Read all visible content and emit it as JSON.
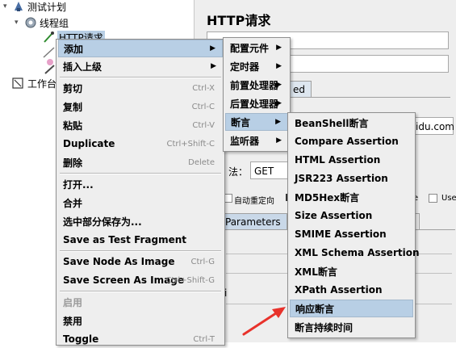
{
  "tree": {
    "root_label": "测试计划",
    "thread_group_label": "线程组",
    "http_request_label": "HTTP请求",
    "workbench_label": "工作台"
  },
  "panel": {
    "title": "HTTP请求",
    "tab_advanced": "ed",
    "server_value": "idu.com",
    "method_label": "法：",
    "method_value": "GET",
    "redirect_label": "自动重定向",
    "e_label": "e",
    "use_label": "Use",
    "tab_parameters": "Parameters",
    "field_i": "i"
  },
  "context_menu": {
    "items": [
      {
        "label": "添加",
        "accel": "",
        "submenu": true
      },
      {
        "label": "插入上级",
        "accel": "",
        "submenu": true
      },
      {
        "label": "剪切",
        "accel": "Ctrl-X"
      },
      {
        "label": "复制",
        "accel": "Ctrl-C"
      },
      {
        "label": "粘贴",
        "accel": "Ctrl-V"
      },
      {
        "label": "Duplicate",
        "accel": "Ctrl+Shift-C"
      },
      {
        "label": "删除",
        "accel": "Delete"
      },
      {
        "label": "打开..."
      },
      {
        "label": "合并"
      },
      {
        "label": "选中部分保存为..."
      },
      {
        "label": "Save as Test Fragment"
      },
      {
        "label": "Save Node As Image",
        "accel": "Ctrl-G"
      },
      {
        "label": "Save Screen As Image",
        "accel": "Ctrl+Shift-G"
      },
      {
        "label": "启用"
      },
      {
        "label": "禁用"
      },
      {
        "label": "Toggle",
        "accel": "Ctrl-T"
      }
    ]
  },
  "add_submenu": {
    "items": [
      {
        "label": "配置元件"
      },
      {
        "label": "定时器"
      },
      {
        "label": "前置处理器"
      },
      {
        "label": "后置处理器"
      },
      {
        "label": "断言"
      },
      {
        "label": "监听器"
      }
    ]
  },
  "assertion_submenu": {
    "items": [
      {
        "label": "BeanShell断言"
      },
      {
        "label": "Compare Assertion"
      },
      {
        "label": "HTML Assertion"
      },
      {
        "label": "JSR223 Assertion"
      },
      {
        "label": "MD5Hex断言"
      },
      {
        "label": "Size Assertion"
      },
      {
        "label": "SMIME Assertion"
      },
      {
        "label": "XML Schema Assertion"
      },
      {
        "label": "XML断言"
      },
      {
        "label": "XPath Assertion"
      },
      {
        "label": "响应断言"
      },
      {
        "label": "断言持续时间"
      }
    ]
  },
  "colors": {
    "highlight": "#b8cfe5",
    "annotation_arrow": "#e8322b"
  },
  "icons": [
    "test-plan-icon",
    "gear-icon",
    "pipette-icon",
    "workbench-icon",
    "submenu-arrow-icon"
  ]
}
